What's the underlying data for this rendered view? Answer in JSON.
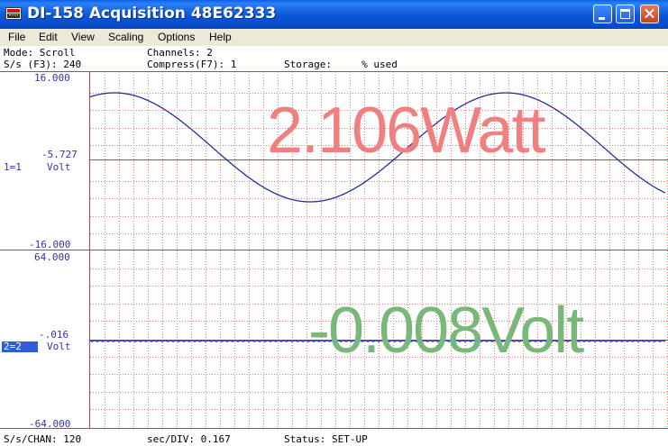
{
  "window": {
    "title": "DI-158 Acquisition 48E62333",
    "icon": "instrument-icon",
    "controls": [
      "minimize-icon",
      "maximize-icon",
      "close-icon"
    ]
  },
  "menu": [
    "File",
    "Edit",
    "View",
    "Scaling",
    "Options",
    "Help"
  ],
  "info": {
    "mode": "Mode: Scroll",
    "channels": "Channels: 2",
    "sample_rate": "S/s (F3): 240",
    "compress": "Compress(F7): 1",
    "storage": "Storage:     % used"
  },
  "channel1": {
    "top": "16.000",
    "mid": "-5.727",
    "bottom": "-16.000",
    "label_num": "1=1",
    "label_unit": "Volt",
    "readout": "2.106Watt",
    "readout_color": "#f08080",
    "trace_color": "#2a2aa0"
  },
  "channel2": {
    "top": "64.000",
    "mid": "-.016",
    "bottom": "-64.000",
    "label_num": "2=2",
    "label_unit": "Volt",
    "readout": "-0.008Volt",
    "readout_color": "#7ab87a",
    "trace_color": "#2a2aa0"
  },
  "grid": {
    "major_color": "#dd3333",
    "minor_color": "#e88080"
  },
  "footer": {
    "schan": "S/s/CHAN: 120",
    "secdiv": "sec/DIV: 0.167",
    "status": "Status: SET-UP"
  }
}
